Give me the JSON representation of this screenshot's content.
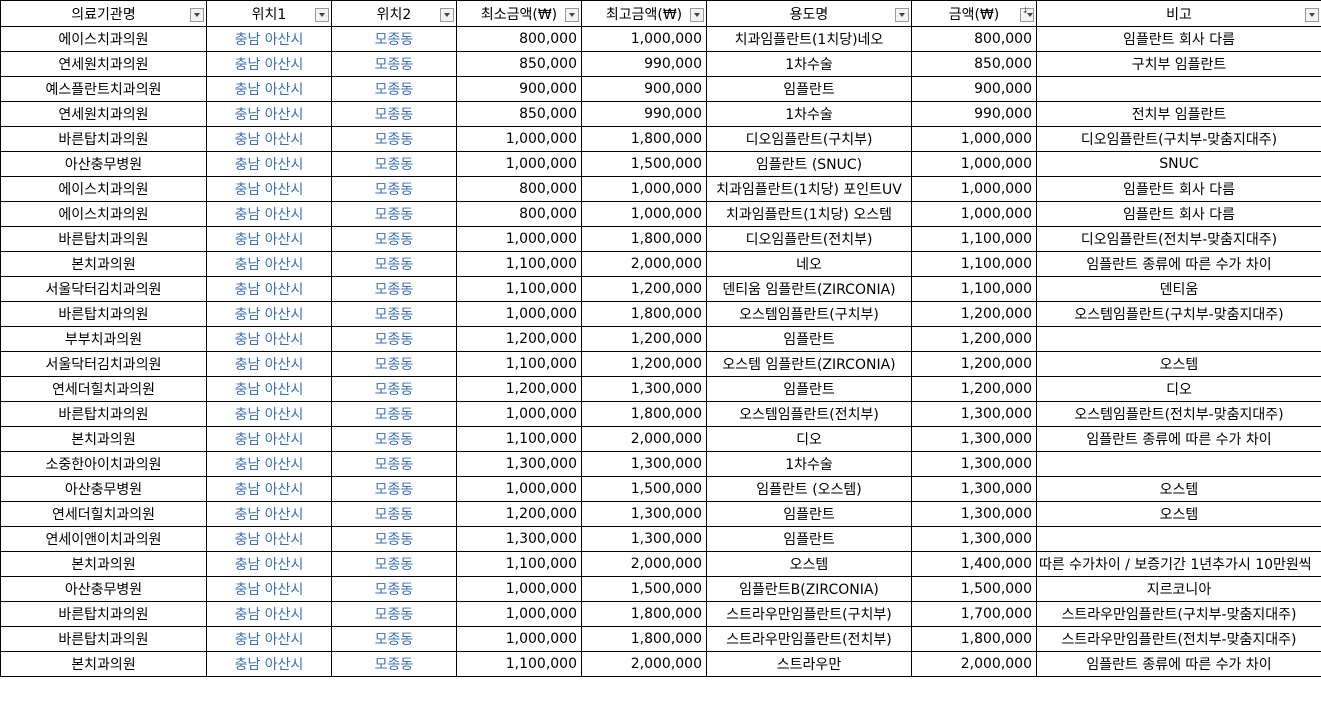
{
  "columns": [
    "의료기관명",
    "위치1",
    "위치2",
    "최소금액(₩)",
    "최고금액(₩)",
    "용도명",
    "금액(₩)",
    "비고"
  ],
  "rows": [
    [
      "에이스치과의원",
      "충남 아산시",
      "모종동",
      "800,000",
      "1,000,000",
      "치과임플란트(1치당)네오",
      "800,000",
      "임플란트 회사 다름"
    ],
    [
      "연세원치과의원",
      "충남 아산시",
      "모종동",
      "850,000",
      "990,000",
      "1차수술",
      "850,000",
      "구치부 임플란트"
    ],
    [
      "예스플란트치과의원",
      "충남 아산시",
      "모종동",
      "900,000",
      "900,000",
      "임플란트",
      "900,000",
      ""
    ],
    [
      "연세원치과의원",
      "충남 아산시",
      "모종동",
      "850,000",
      "990,000",
      "1차수술",
      "990,000",
      "전치부 임플란트"
    ],
    [
      "바른탑치과의원",
      "충남 아산시",
      "모종동",
      "1,000,000",
      "1,800,000",
      "디오임플란트(구치부)",
      "1,000,000",
      "디오임플란트(구치부-맞춤지대주)"
    ],
    [
      "아산충무병원",
      "충남 아산시",
      "모종동",
      "1,000,000",
      "1,500,000",
      "임플란트 (SNUC)",
      "1,000,000",
      "SNUC"
    ],
    [
      "에이스치과의원",
      "충남 아산시",
      "모종동",
      "800,000",
      "1,000,000",
      "치과임플란트(1치당) 포인트UV",
      "1,000,000",
      "임플란트 회사 다름"
    ],
    [
      "에이스치과의원",
      "충남 아산시",
      "모종동",
      "800,000",
      "1,000,000",
      "치과임플란트(1치당) 오스템",
      "1,000,000",
      "임플란트 회사 다름"
    ],
    [
      "바른탑치과의원",
      "충남 아산시",
      "모종동",
      "1,000,000",
      "1,800,000",
      "디오임플란트(전치부)",
      "1,100,000",
      "디오임플란트(전치부-맞춤지대주)"
    ],
    [
      "본치과의원",
      "충남 아산시",
      "모종동",
      "1,100,000",
      "2,000,000",
      "네오",
      "1,100,000",
      "임플란트 종류에 따른 수가 차이"
    ],
    [
      "서울닥터김치과의원",
      "충남 아산시",
      "모종동",
      "1,100,000",
      "1,200,000",
      "덴티움 임플란트(ZIRCONIA)",
      "1,100,000",
      "덴티움"
    ],
    [
      "바른탑치과의원",
      "충남 아산시",
      "모종동",
      "1,000,000",
      "1,800,000",
      "오스템임플란트(구치부)",
      "1,200,000",
      "오스템임플란트(구치부-맞춤지대주)"
    ],
    [
      "부부치과의원",
      "충남 아산시",
      "모종동",
      "1,200,000",
      "1,200,000",
      "임플란트",
      "1,200,000",
      ""
    ],
    [
      "서울닥터김치과의원",
      "충남 아산시",
      "모종동",
      "1,100,000",
      "1,200,000",
      "오스템 임플란트(ZIRCONIA)",
      "1,200,000",
      "오스템"
    ],
    [
      "연세더힐치과의원",
      "충남 아산시",
      "모종동",
      "1,200,000",
      "1,300,000",
      "임플란트",
      "1,200,000",
      "디오"
    ],
    [
      "바른탑치과의원",
      "충남 아산시",
      "모종동",
      "1,000,000",
      "1,800,000",
      "오스템임플란트(전치부)",
      "1,300,000",
      "오스템임플란트(전치부-맞춤지대주)"
    ],
    [
      "본치과의원",
      "충남 아산시",
      "모종동",
      "1,100,000",
      "2,000,000",
      "디오",
      "1,300,000",
      "임플란트 종류에 따른 수가 차이"
    ],
    [
      "소중한아이치과의원",
      "충남 아산시",
      "모종동",
      "1,300,000",
      "1,300,000",
      "1차수술",
      "1,300,000",
      ""
    ],
    [
      "아산충무병원",
      "충남 아산시",
      "모종동",
      "1,000,000",
      "1,500,000",
      "임플란트 (오스템)",
      "1,300,000",
      "오스템"
    ],
    [
      "연세더힐치과의원",
      "충남 아산시",
      "모종동",
      "1,200,000",
      "1,300,000",
      "임플란트",
      "1,300,000",
      "오스템"
    ],
    [
      "연세이앤이치과의원",
      "충남 아산시",
      "모종동",
      "1,300,000",
      "1,300,000",
      "임플란트",
      "1,300,000",
      ""
    ],
    [
      "본치과의원",
      "충남 아산시",
      "모종동",
      "1,100,000",
      "2,000,000",
      "오스템",
      "1,400,000",
      "따른 수가차이 / 보증기간 1년추가시 10만원씩"
    ],
    [
      "아산충무병원",
      "충남 아산시",
      "모종동",
      "1,000,000",
      "1,500,000",
      "임플란트B(ZIRCONIA)",
      "1,500,000",
      "지르코니아"
    ],
    [
      "바른탑치과의원",
      "충남 아산시",
      "모종동",
      "1,000,000",
      "1,800,000",
      "스트라우만임플란트(구치부)",
      "1,700,000",
      "스트라우만임플란트(구치부-맞춤지대주)"
    ],
    [
      "바른탑치과의원",
      "충남 아산시",
      "모종동",
      "1,000,000",
      "1,800,000",
      "스트라우만임플란트(전치부)",
      "1,800,000",
      "스트라우만임플란트(전치부-맞춤지대주)"
    ],
    [
      "본치과의원",
      "충남 아산시",
      "모종동",
      "1,100,000",
      "2,000,000",
      "스트라우만",
      "2,000,000",
      "임플란트 종류에 따른 수가 차이"
    ]
  ]
}
